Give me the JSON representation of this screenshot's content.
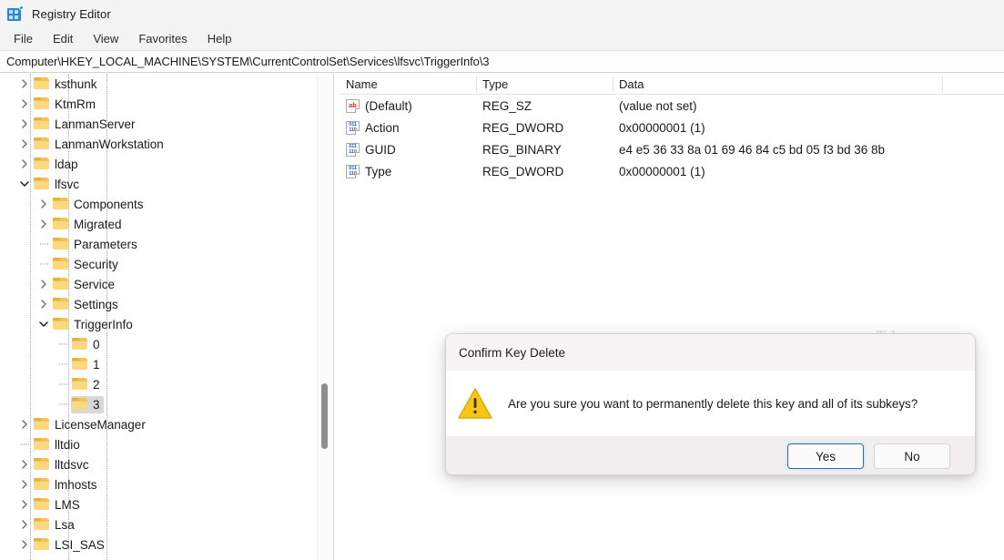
{
  "window": {
    "title": "Registry Editor",
    "icon": "registry-editor-icon"
  },
  "menubar": {
    "items": [
      {
        "label": "File"
      },
      {
        "label": "Edit"
      },
      {
        "label": "View"
      },
      {
        "label": "Favorites"
      },
      {
        "label": "Help"
      }
    ]
  },
  "address": {
    "path": "Computer\\HKEY_LOCAL_MACHINE\\SYSTEM\\CurrentControlSet\\Services\\lfsvc\\TriggerInfo\\3"
  },
  "tree": {
    "items": [
      {
        "label": "ksthunk",
        "depth": 1,
        "arrow": "collapsed",
        "selected": false
      },
      {
        "label": "KtmRm",
        "depth": 1,
        "arrow": "collapsed",
        "selected": false
      },
      {
        "label": "LanmanServer",
        "depth": 1,
        "arrow": "collapsed",
        "selected": false
      },
      {
        "label": "LanmanWorkstation",
        "depth": 1,
        "arrow": "collapsed",
        "selected": false
      },
      {
        "label": "ldap",
        "depth": 1,
        "arrow": "collapsed",
        "selected": false
      },
      {
        "label": "lfsvc",
        "depth": 1,
        "arrow": "expanded",
        "selected": false
      },
      {
        "label": "Components",
        "depth": 2,
        "arrow": "collapsed",
        "selected": false
      },
      {
        "label": "Migrated",
        "depth": 2,
        "arrow": "collapsed",
        "selected": false
      },
      {
        "label": "Parameters",
        "depth": 2,
        "arrow": "leaf",
        "selected": false
      },
      {
        "label": "Security",
        "depth": 2,
        "arrow": "leaf",
        "selected": false
      },
      {
        "label": "Service",
        "depth": 2,
        "arrow": "collapsed",
        "selected": false
      },
      {
        "label": "Settings",
        "depth": 2,
        "arrow": "collapsed",
        "selected": false
      },
      {
        "label": "TriggerInfo",
        "depth": 2,
        "arrow": "expanded",
        "selected": false
      },
      {
        "label": "0",
        "depth": 3,
        "arrow": "leaf",
        "selected": false
      },
      {
        "label": "1",
        "depth": 3,
        "arrow": "leaf",
        "selected": false
      },
      {
        "label": "2",
        "depth": 3,
        "arrow": "leaf",
        "selected": false
      },
      {
        "label": "3",
        "depth": 3,
        "arrow": "leaf",
        "selected": true
      },
      {
        "label": "LicenseManager",
        "depth": 1,
        "arrow": "collapsed",
        "selected": false
      },
      {
        "label": "lltdio",
        "depth": 1,
        "arrow": "leaf",
        "selected": false
      },
      {
        "label": "lltdsvc",
        "depth": 1,
        "arrow": "collapsed",
        "selected": false
      },
      {
        "label": "lmhosts",
        "depth": 1,
        "arrow": "collapsed",
        "selected": false
      },
      {
        "label": "LMS",
        "depth": 1,
        "arrow": "collapsed",
        "selected": false
      },
      {
        "label": "Lsa",
        "depth": 1,
        "arrow": "collapsed",
        "selected": false
      },
      {
        "label": "LSI_SAS",
        "depth": 1,
        "arrow": "collapsed",
        "selected": false
      }
    ]
  },
  "values": {
    "columns": [
      "Name",
      "Type",
      "Data"
    ],
    "rows": [
      {
        "icon": "string-value-icon",
        "icon_kind": "sz",
        "name": "(Default)",
        "type": "REG_SZ",
        "data": "(value not set)"
      },
      {
        "icon": "binary-value-icon",
        "icon_kind": "bin",
        "name": "Action",
        "type": "REG_DWORD",
        "data": "0x00000001 (1)"
      },
      {
        "icon": "binary-value-icon",
        "icon_kind": "bin",
        "name": "GUID",
        "type": "REG_BINARY",
        "data": "e4 e5 36 33 8a 01 69 46 84 c5 bd 05 f3 bd 36 8b"
      },
      {
        "icon": "binary-value-icon",
        "icon_kind": "bin",
        "name": "Type",
        "type": "REG_DWORD",
        "data": "0x00000001 (1)"
      }
    ]
  },
  "dialog": {
    "title": "Confirm Key Delete",
    "message": "Are you sure you want to permanently delete this key and all of its subkeys?",
    "icon": "warning-triangle-icon",
    "buttons": [
      {
        "label": "Yes",
        "default": true
      },
      {
        "label": "No",
        "default": false
      }
    ]
  },
  "watermark": {
    "text": "Tekzone.vn"
  },
  "colors": {
    "folder": "#fcd980",
    "folder_shade": "#f5c253",
    "warning": "#f5c518",
    "accent": "#3e6b8c",
    "selection": "#d8d8d8"
  }
}
